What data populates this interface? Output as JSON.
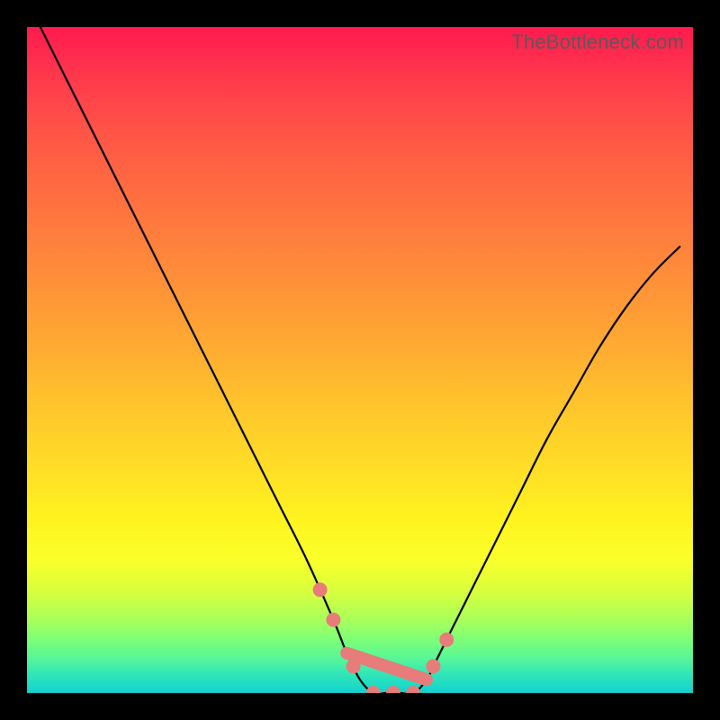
{
  "watermark": "TheBottleneck.com",
  "colors": {
    "frame": "#000000",
    "curve": "#000000",
    "marker": "#e77c7a",
    "gradient_top": "#ff1a4f",
    "gradient_bottom": "#16d0d0"
  },
  "chart_data": {
    "type": "line",
    "title": "",
    "xlabel": "",
    "ylabel": "",
    "xlim": [
      0,
      100
    ],
    "ylim": [
      0,
      100
    ],
    "note": "y is bottleneck severity percentage; 0 = perfect match at trough; plotted over normalized component-balance axis x",
    "series": [
      {
        "name": "bottleneck-curve",
        "x": [
          2,
          6,
          10,
          14,
          18,
          22,
          26,
          30,
          34,
          38,
          42,
          46,
          48,
          50,
          52,
          54,
          56,
          58,
          60,
          62,
          66,
          70,
          74,
          78,
          82,
          86,
          90,
          94,
          98
        ],
        "values": [
          100,
          92,
          84,
          76,
          68,
          60,
          52,
          44,
          36,
          28,
          20,
          11,
          6,
          2,
          0,
          0,
          0,
          0,
          2,
          6,
          14,
          22,
          30,
          38,
          45,
          52,
          58,
          63,
          67
        ]
      }
    ],
    "annotations": {
      "highlight_points_x": [
        44,
        46,
        49,
        52,
        55,
        58,
        61,
        63
      ],
      "trough_segment_x": [
        48,
        60
      ]
    }
  }
}
